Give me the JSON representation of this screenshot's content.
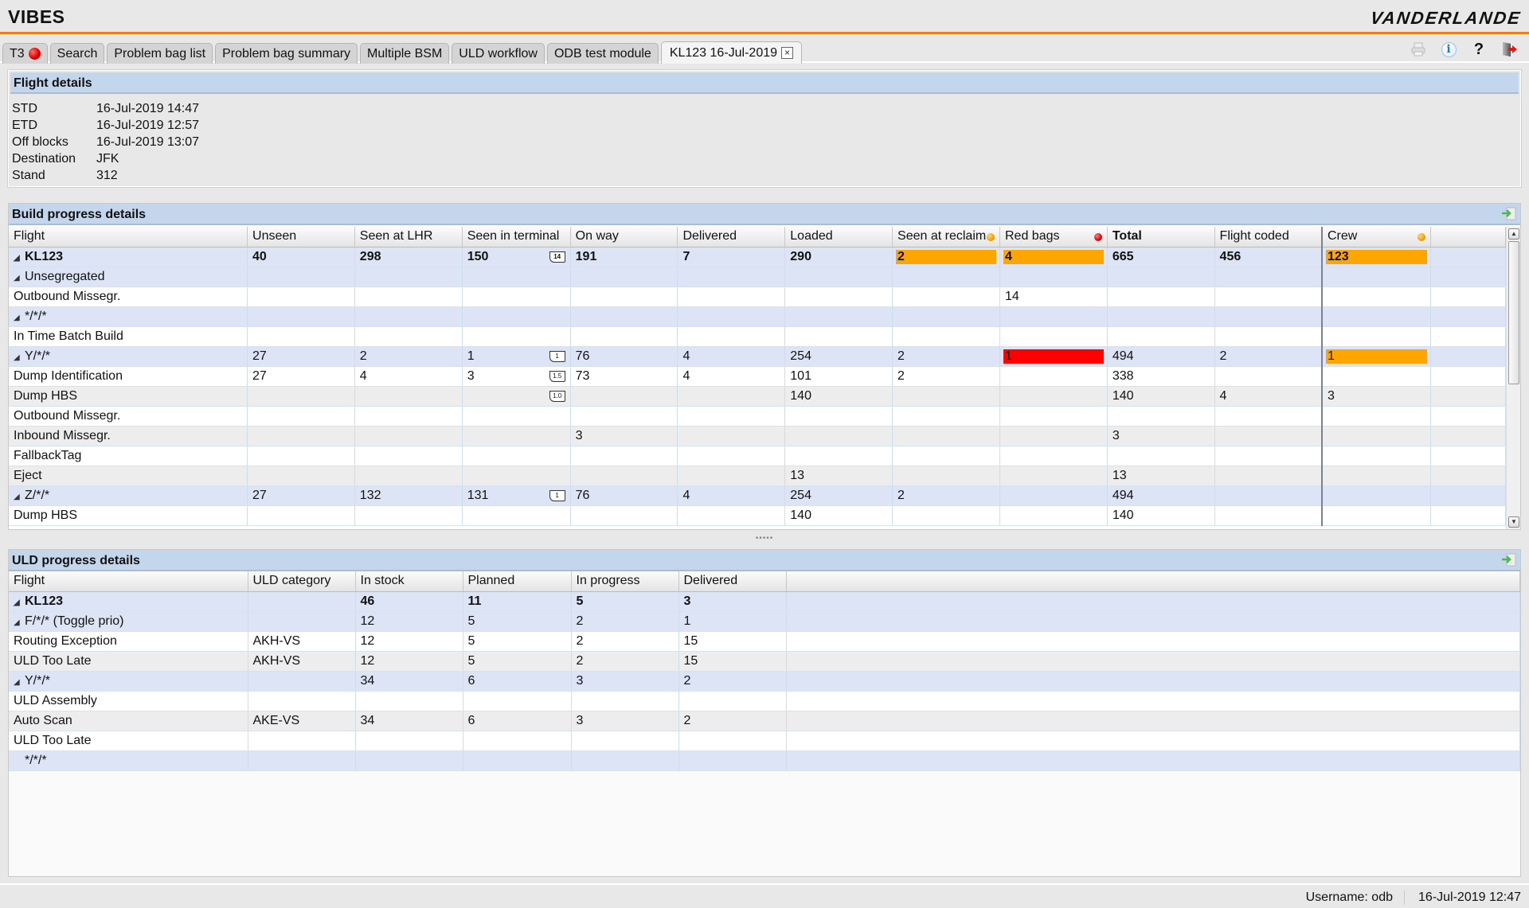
{
  "app": {
    "title": "VIBES",
    "brand": "VANDERLANDE"
  },
  "tabs": [
    {
      "label": "T3",
      "alert": true
    },
    {
      "label": "Search"
    },
    {
      "label": "Problem bag list"
    },
    {
      "label": "Problem bag summary"
    },
    {
      "label": "Multiple BSM"
    },
    {
      "label": "ULD workflow"
    },
    {
      "label": "ODB test module"
    },
    {
      "label": "KL123 16-Jul-2019",
      "active": true,
      "closable": true
    }
  ],
  "toolbar": {
    "print": "print-icon",
    "info": "i",
    "help": "?",
    "logout": "logout-icon"
  },
  "flight_details": {
    "title": "Flight details",
    "rows": [
      {
        "label": "STD",
        "value": "16-Jul-2019 14:47"
      },
      {
        "label": "ETD",
        "value": "16-Jul-2019 12:57"
      },
      {
        "label": "Off blocks",
        "value": "16-Jul-2019 13:07"
      },
      {
        "label": "Destination",
        "value": "JFK"
      },
      {
        "label": "Stand",
        "value": "312"
      }
    ]
  },
  "build_progress": {
    "title": "Build progress details",
    "columns": [
      "Flight",
      "Unseen",
      "Seen at LHR",
      "Seen in terminal",
      "On way",
      "Delivered",
      "Loaded",
      "Seen at reclaim",
      "Red bags",
      "Total",
      "Flight coded",
      "Crew"
    ],
    "column_alerts": {
      "Seen at reclaim": "#f5a000",
      "Red bags": "#e00000",
      "Crew": "#f5a000"
    },
    "rows": [
      {
        "level": 1,
        "expandable": true,
        "flight": "KL123",
        "bold": true,
        "unseen": "40",
        "seen_lhr": "298",
        "seen_terminal": "150",
        "terminal_tag": "14",
        "on_way": "191",
        "delivered": "7",
        "loaded": "290",
        "seen_reclaim": "2",
        "seen_reclaim_hl": "orange",
        "red_bags": "4",
        "red_bags_hl": "orange",
        "total": "665",
        "flight_coded": "456",
        "crew": "123",
        "crew_hl": "orange"
      },
      {
        "level": 2,
        "expandable": true,
        "flight": "Unsegregated"
      },
      {
        "level": 3,
        "flight": "Outbound Missegr.",
        "red_bags": "14"
      },
      {
        "level": 2,
        "expandable": true,
        "flight": "*/*/*"
      },
      {
        "level": 3,
        "flight": "In Time Batch Build"
      },
      {
        "level": 2,
        "expandable": true,
        "flight": "Y/*/*",
        "unseen": "27",
        "seen_lhr": "2",
        "seen_terminal": "1",
        "terminal_tag": "1",
        "on_way": "76",
        "delivered": "4",
        "loaded": "254",
        "seen_reclaim": "2",
        "red_bags": "1",
        "red_bags_hl": "red",
        "total": "494",
        "flight_coded": "2",
        "crew": "1",
        "crew_hl": "orange"
      },
      {
        "level": 3,
        "flight": "Dump Identification",
        "unseen": "27",
        "seen_lhr": "4",
        "seen_terminal": "3",
        "terminal_tag": "1.5",
        "on_way": "73",
        "delivered": "4",
        "loaded": "101",
        "seen_reclaim": "2",
        "total": "338"
      },
      {
        "level": 3,
        "flight": "Dump HBS",
        "terminal_tag": "1.0",
        "loaded": "140",
        "total": "140",
        "flight_coded": "4",
        "crew": "3"
      },
      {
        "level": 3,
        "flight": "Outbound Missegr."
      },
      {
        "level": 3,
        "flight": "Inbound Missegr.",
        "on_way": "3",
        "total": "3"
      },
      {
        "level": 3,
        "flight": "FallbackTag"
      },
      {
        "level": 3,
        "flight": "Eject",
        "loaded": "13",
        "total": "13"
      },
      {
        "level": 2,
        "expandable": true,
        "flight": "Z/*/*",
        "unseen": "27",
        "seen_lhr": "132",
        "seen_terminal": "131",
        "terminal_tag": "1",
        "on_way": "76",
        "delivered": "4",
        "loaded": "254",
        "seen_reclaim": "2",
        "total": "494"
      },
      {
        "level": 3,
        "flight": "Dump HBS",
        "loaded": "140",
        "total": "140"
      }
    ]
  },
  "uld_progress": {
    "title": "ULD progress details",
    "columns": [
      "Flight",
      "ULD category",
      "In stock",
      "Planned",
      "In progress",
      "Delivered"
    ],
    "rows": [
      {
        "level": 1,
        "expandable": true,
        "bold": true,
        "flight": "KL123",
        "category": "",
        "in_stock": "46",
        "planned": "11",
        "in_progress": "5",
        "delivered": "3"
      },
      {
        "level": 2,
        "expandable": true,
        "flight": "F/*/* (Toggle prio)",
        "category": "",
        "in_stock": "12",
        "planned": "5",
        "in_progress": "2",
        "delivered": "1"
      },
      {
        "level": 3,
        "flight": "Routing Exception",
        "category": "AKH-VS",
        "in_stock": "12",
        "planned": "5",
        "in_progress": "2",
        "delivered": "15"
      },
      {
        "level": 3,
        "flight": "ULD Too Late",
        "category": "AKH-VS",
        "in_stock": "12",
        "planned": "5",
        "in_progress": "2",
        "delivered": "15"
      },
      {
        "level": 2,
        "expandable": true,
        "flight": "Y/*/*",
        "category": "",
        "in_stock": "34",
        "planned": "6",
        "in_progress": "3",
        "delivered": "2"
      },
      {
        "level": 3,
        "flight": "ULD Assembly"
      },
      {
        "level": 3,
        "flight": "Auto Scan",
        "category": "AKE-VS",
        "in_stock": "34",
        "planned": "6",
        "in_progress": "3",
        "delivered": "2"
      },
      {
        "level": 3,
        "flight": "ULD Too Late"
      },
      {
        "level": 2,
        "expandable": false,
        "flight": "*/*/*"
      }
    ]
  },
  "status": {
    "username": "Username: odb",
    "datetime": "16-Jul-2019 12:47"
  },
  "colors": {
    "accent": "#f07c1a",
    "panel_header": "#c4d6ec",
    "group_row": "#dce4f5",
    "highlight_orange": "#ffa500",
    "highlight_red": "#ff0000"
  }
}
